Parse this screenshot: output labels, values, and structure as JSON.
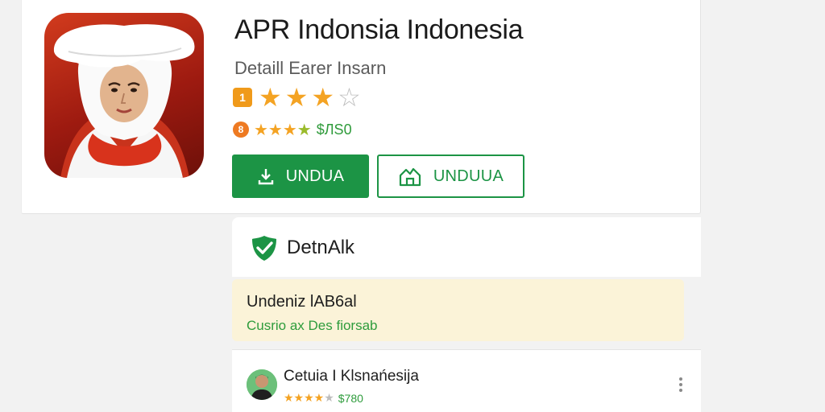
{
  "app": {
    "title": "APR Indonsia Indonesia",
    "subtitle": "Detaill Earer Insarn",
    "rating_badge": "1",
    "stars_filled": 3,
    "stars_total": 4,
    "meta_badge": "8",
    "meta_value": "$ЛS0"
  },
  "buttons": {
    "primary_label": "UNDUA",
    "primary_icon": "download-icon",
    "secondary_label": "UNDUUA",
    "secondary_icon": "share-house-icon"
  },
  "details": {
    "title": "DetnAlk",
    "icon": "check-shield-icon"
  },
  "notice": {
    "title": "Undeniz lAB6al",
    "subtitle": "Cusrio ax Des fiorsab"
  },
  "review": {
    "reviewer_name": "Cetuia I Klsnańesija",
    "rating_value": "$780",
    "stars_filled": 4,
    "stars_total": 5
  },
  "colors": {
    "accent_green": "#1c9445",
    "star_orange": "#f4a323",
    "notice_bg": "#fbf3d8",
    "icon_red": "#c7301a"
  }
}
